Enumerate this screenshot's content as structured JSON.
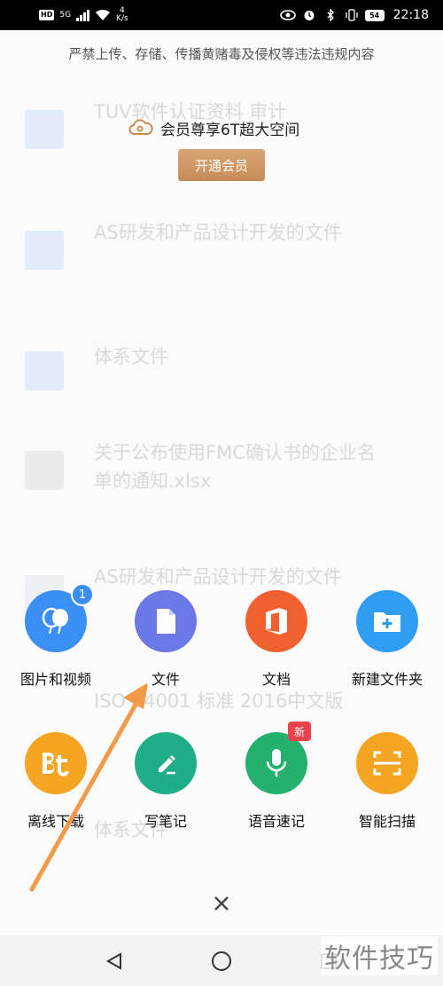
{
  "status_bar": {
    "hd_badge": "HD",
    "network": "5G",
    "speed_value": "4",
    "speed_unit": "K/s",
    "battery": "54",
    "time": "22:18"
  },
  "notice": "严禁上传、存储、传播黄赌毒及侵权等违法违规内容",
  "promo": {
    "text": "会员尊享6T超大空间",
    "button": "开通会员"
  },
  "background_files": [
    {
      "title": "TUV软件认证资料 审计",
      "meta": ""
    },
    {
      "title": "AS研发和产品设计开发的文件",
      "meta": ""
    },
    {
      "title": "体系文件",
      "meta": ""
    },
    {
      "title": "关于公布使用FMC确认书的企业名单的通知.xlsx",
      "meta": ""
    },
    {
      "title": "AS研发和产品设计开发的文件",
      "meta": ""
    },
    {
      "title": "ISO 14001 标准 2016中文版",
      "meta": ""
    },
    {
      "title": "体系文件",
      "meta": ""
    }
  ],
  "actions": [
    {
      "label": "图片和视频",
      "icon": "balloons-icon",
      "color": "#3b8ff3",
      "badge": "1"
    },
    {
      "label": "文件",
      "icon": "document-icon",
      "color": "#6b78e6"
    },
    {
      "label": "文档",
      "icon": "office-icon",
      "color": "#f0612f"
    },
    {
      "label": "新建文件夹",
      "icon": "new-folder-icon",
      "color": "#2f9df2"
    },
    {
      "label": "离线下载",
      "icon": "bt-icon",
      "color": "#f5a524"
    },
    {
      "label": "写笔记",
      "icon": "pencil-icon",
      "color": "#1fae87"
    },
    {
      "label": "语音速记",
      "icon": "microphone-icon",
      "color": "#26b06d",
      "badge": "新"
    },
    {
      "label": "智能扫描",
      "icon": "scan-icon",
      "color": "#f5a524"
    }
  ],
  "close_icon": "close-icon",
  "watermark": "软件技巧",
  "colors": {
    "accent_gold": "#c78b58",
    "arrow": "#f29a4a"
  }
}
